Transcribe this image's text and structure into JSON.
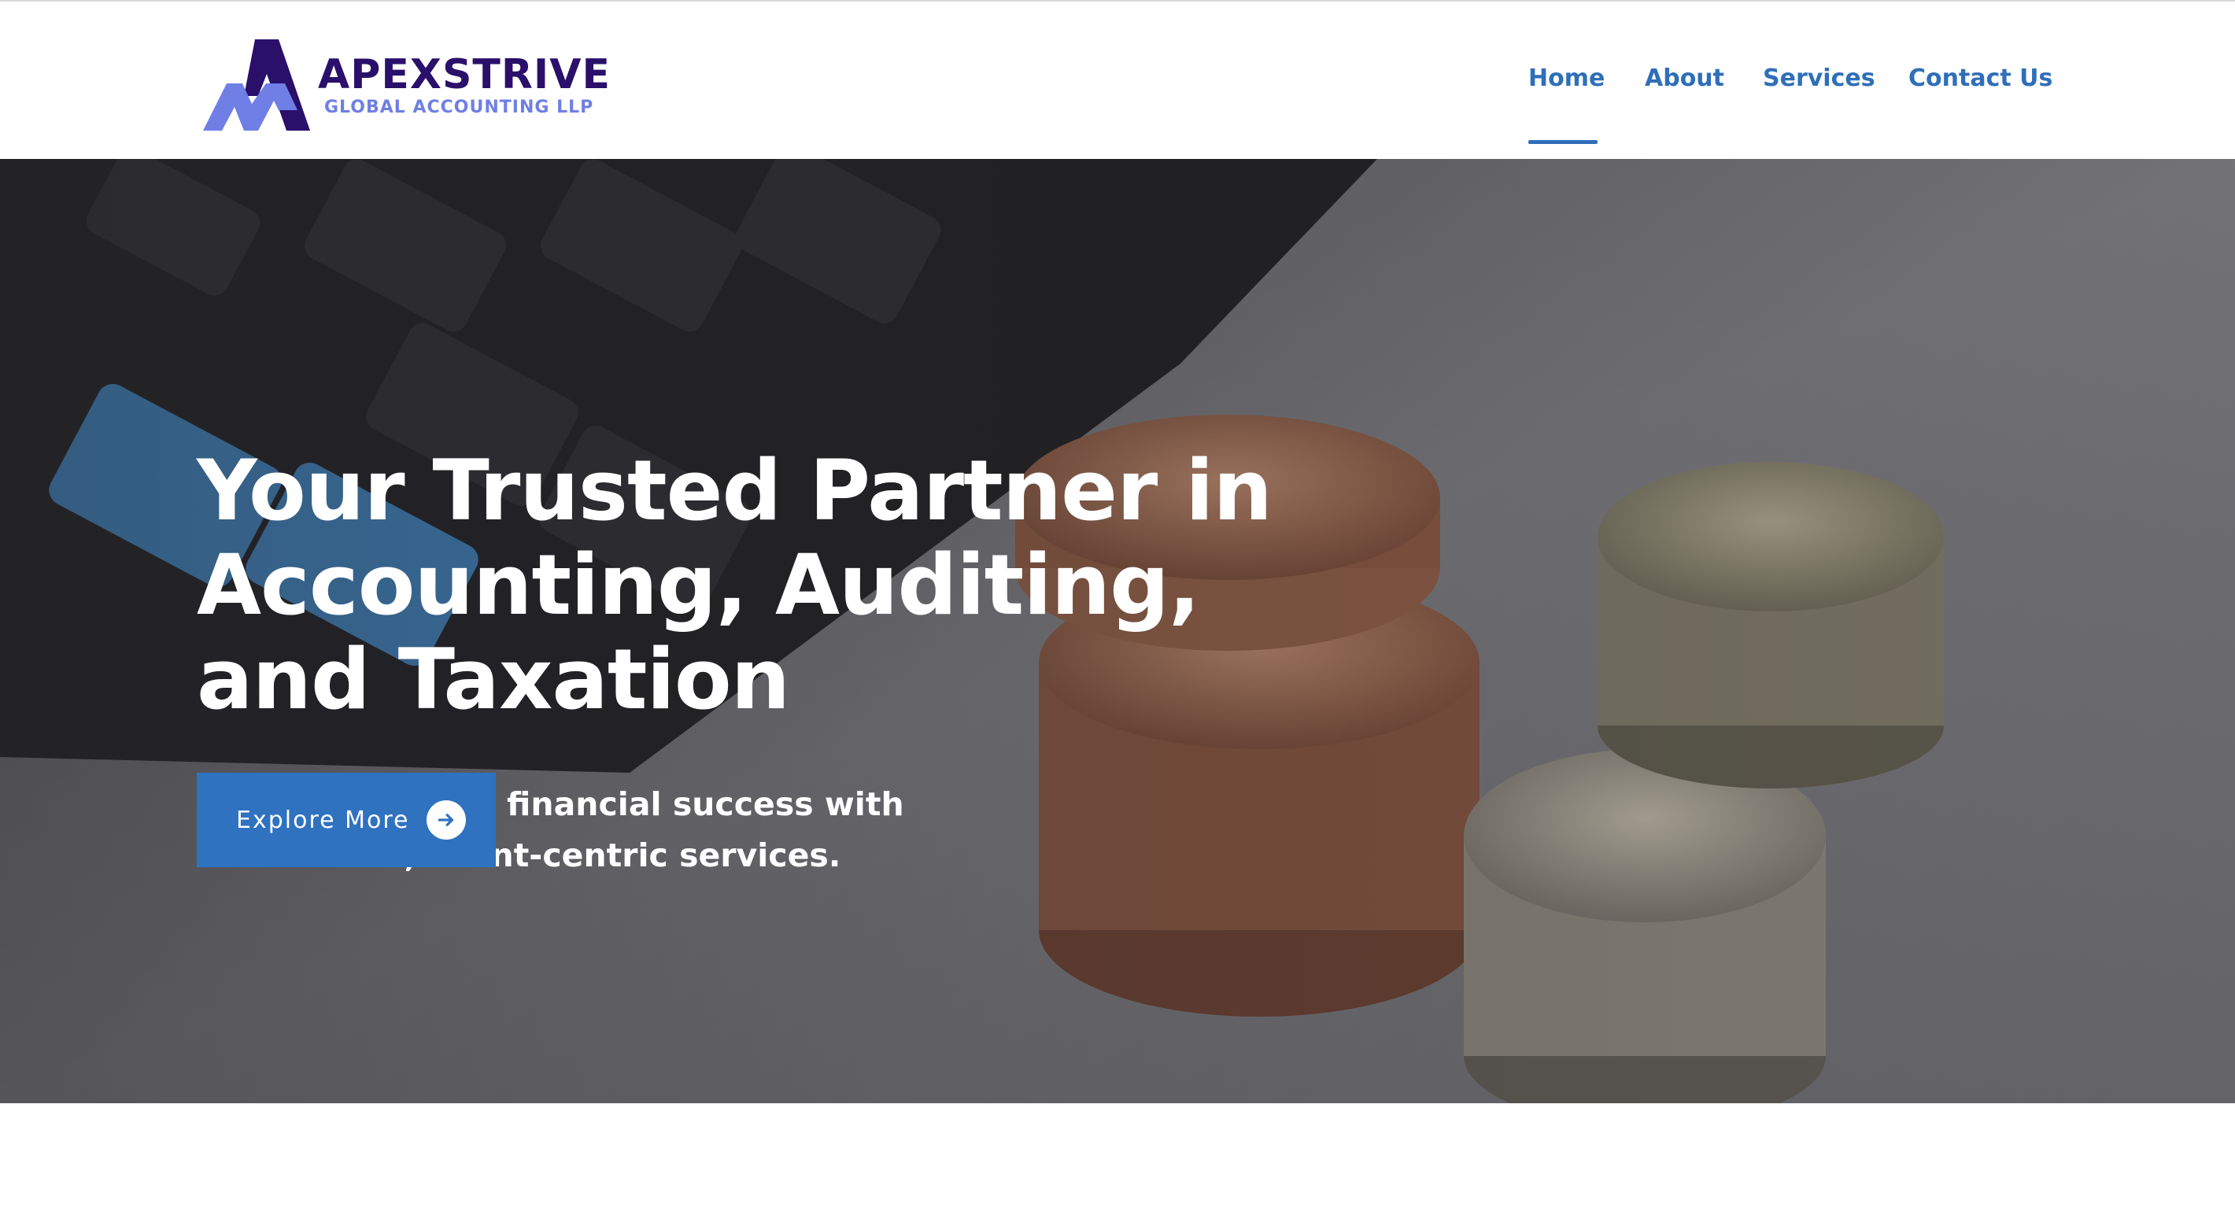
{
  "brand": {
    "name": "APEXSTRIVE",
    "tagline": "GLOBAL ACCOUNTING LLP",
    "primary_color": "#2a0f6b",
    "secondary_color": "#6f7fe6"
  },
  "nav": {
    "items": [
      {
        "label": "Home",
        "active": true
      },
      {
        "label": "About",
        "active": false
      },
      {
        "label": "Services",
        "active": false
      },
      {
        "label": "Contact Us",
        "active": false
      }
    ],
    "link_color": "#2f6fb9"
  },
  "hero": {
    "title": "Your Trusted Partner in Accounting, Auditing, and Taxation",
    "subtitle": "Focused on your financial success with customized, client-centric services.",
    "cta_label": "Explore More",
    "cta_icon": "arrow-right-circle-icon",
    "cta_color": "#2f72c0",
    "background": "calculator-and-coins-photo"
  }
}
